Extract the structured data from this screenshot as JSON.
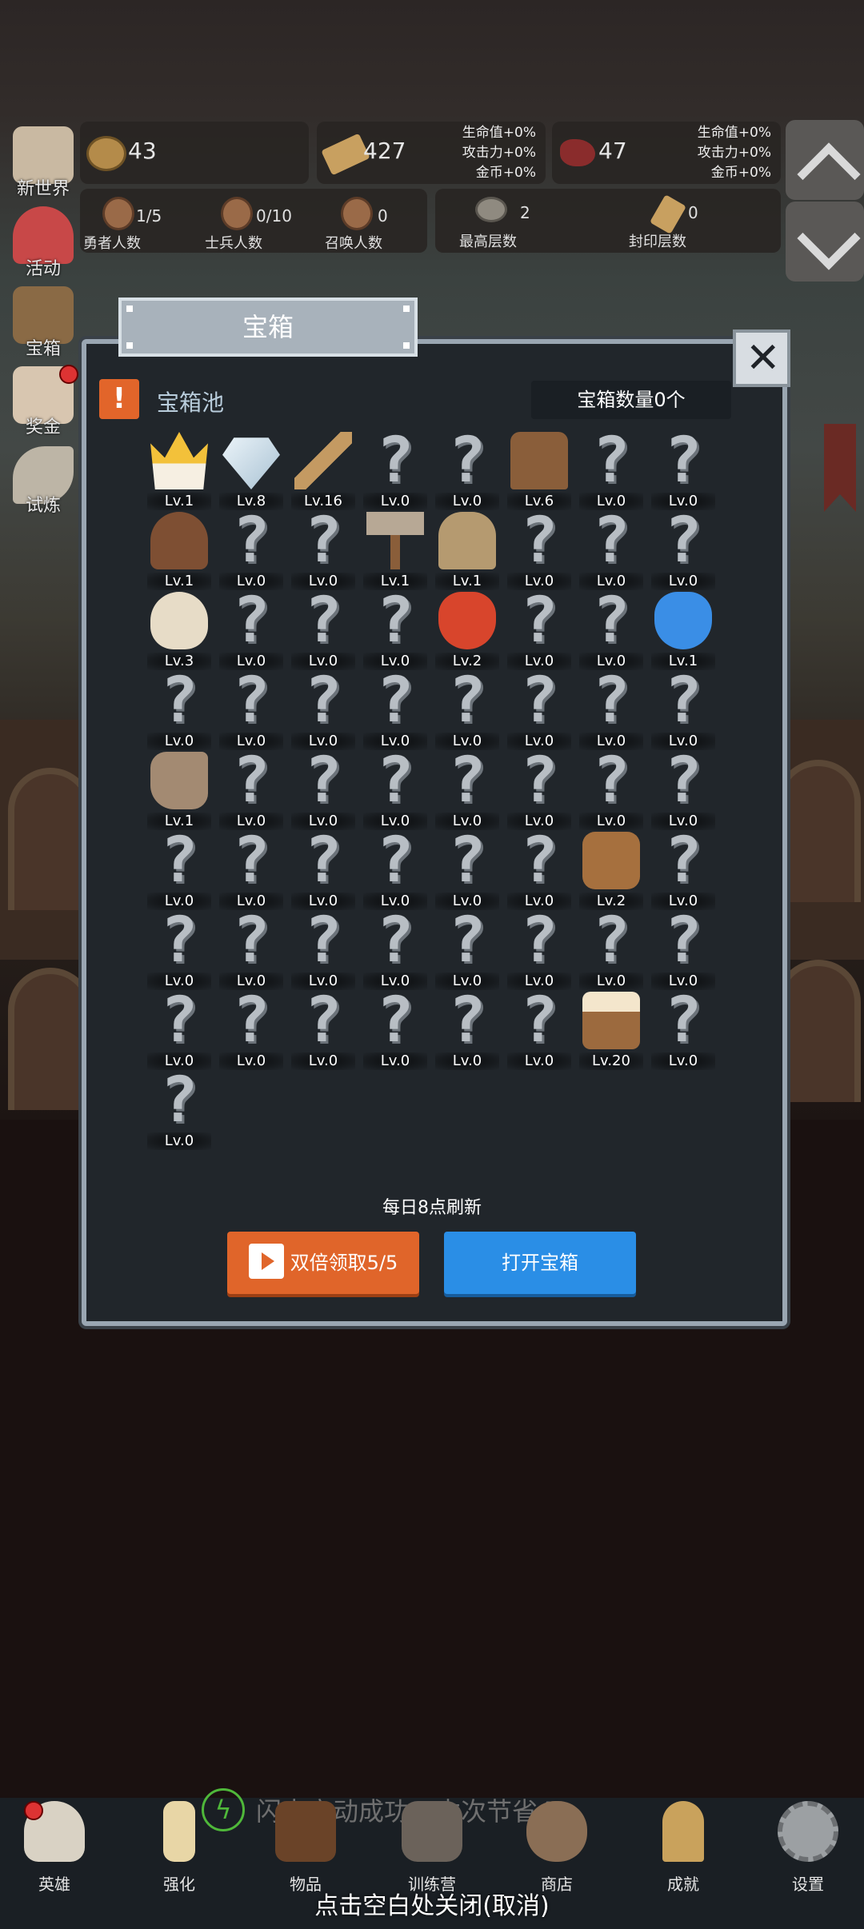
{
  "resources": [
    {
      "name": "coin",
      "value": "43",
      "icon": "coin-icon"
    },
    {
      "name": "wood",
      "value": "427",
      "icon": "wood-icon",
      "bonus": [
        "生命值+0%",
        "攻击力+0%",
        "金币+0%"
      ]
    },
    {
      "name": "meat",
      "value": "47",
      "icon": "meat-icon",
      "bonus": [
        "生命值+0%",
        "攻击力+0%",
        "金币+0%"
      ]
    }
  ],
  "stats": [
    {
      "label": "勇者人数",
      "value": "1/5"
    },
    {
      "label": "士兵人数",
      "value": "0/10"
    },
    {
      "label": "召唤人数",
      "value": "0"
    },
    {
      "label": "最高层数",
      "value": "2"
    },
    {
      "label": "封印层数",
      "value": "0"
    }
  ],
  "side_menu": [
    {
      "label": "新世界",
      "icon": "map-icon"
    },
    {
      "label": "活动",
      "icon": "heart-icon"
    },
    {
      "label": "宝箱",
      "icon": "chest-icon"
    },
    {
      "label": "奖金",
      "icon": "letter-icon"
    },
    {
      "label": "试炼",
      "icon": "feather-icon"
    }
  ],
  "modal": {
    "title": "宝箱",
    "pool_title": "宝箱池",
    "pool_alert": "!",
    "chest_count": "宝箱数量0个",
    "refresh_note": "每日8点刷新",
    "double_claim": "双倍领取5/5",
    "open_chest": "打开宝箱",
    "close_glyph": "✕"
  },
  "items": [
    {
      "icon": "crown-icon",
      "level": "Lv.1"
    },
    {
      "icon": "diamond-icon",
      "level": "Lv.8"
    },
    {
      "icon": "sword-icon",
      "level": "Lv.16"
    },
    {
      "icon": "unknown-icon",
      "level": "Lv.0"
    },
    {
      "icon": "unknown-icon",
      "level": "Lv.0"
    },
    {
      "icon": "armor-icon",
      "level": "Lv.6"
    },
    {
      "icon": "unknown-icon",
      "level": "Lv.0"
    },
    {
      "icon": "unknown-icon",
      "level": "Lv.0"
    },
    {
      "icon": "leather-helmet-icon",
      "level": "Lv.1"
    },
    {
      "icon": "unknown-icon",
      "level": "Lv.0"
    },
    {
      "icon": "unknown-icon",
      "level": "Lv.0"
    },
    {
      "icon": "hammer-icon",
      "level": "Lv.1"
    },
    {
      "icon": "knight-helmet-icon",
      "level": "Lv.1"
    },
    {
      "icon": "unknown-icon",
      "level": "Lv.0"
    },
    {
      "icon": "unknown-icon",
      "level": "Lv.0"
    },
    {
      "icon": "unknown-icon",
      "level": "Lv.0"
    },
    {
      "icon": "flour-icon",
      "level": "Lv.3"
    },
    {
      "icon": "unknown-icon",
      "level": "Lv.0"
    },
    {
      "icon": "unknown-icon",
      "level": "Lv.0"
    },
    {
      "icon": "unknown-icon",
      "level": "Lv.0"
    },
    {
      "icon": "red-potion-icon",
      "level": "Lv.2"
    },
    {
      "icon": "unknown-icon",
      "level": "Lv.0"
    },
    {
      "icon": "unknown-icon",
      "level": "Lv.0"
    },
    {
      "icon": "blue-potion-icon",
      "level": "Lv.1"
    },
    {
      "icon": "unknown-icon",
      "level": "Lv.0"
    },
    {
      "icon": "unknown-icon",
      "level": "Lv.0"
    },
    {
      "icon": "unknown-icon",
      "level": "Lv.0"
    },
    {
      "icon": "unknown-icon",
      "level": "Lv.0"
    },
    {
      "icon": "unknown-icon",
      "level": "Lv.0"
    },
    {
      "icon": "unknown-icon",
      "level": "Lv.0"
    },
    {
      "icon": "unknown-icon",
      "level": "Lv.0"
    },
    {
      "icon": "unknown-icon",
      "level": "Lv.0"
    },
    {
      "icon": "boot-icon",
      "level": "Lv.1"
    },
    {
      "icon": "unknown-icon",
      "level": "Lv.0"
    },
    {
      "icon": "unknown-icon",
      "level": "Lv.0"
    },
    {
      "icon": "unknown-icon",
      "level": "Lv.0"
    },
    {
      "icon": "unknown-icon",
      "level": "Lv.0"
    },
    {
      "icon": "unknown-icon",
      "level": "Lv.0"
    },
    {
      "icon": "unknown-icon",
      "level": "Lv.0"
    },
    {
      "icon": "unknown-icon",
      "level": "Lv.0"
    },
    {
      "icon": "unknown-icon",
      "level": "Lv.0"
    },
    {
      "icon": "unknown-icon",
      "level": "Lv.0"
    },
    {
      "icon": "unknown-icon",
      "level": "Lv.0"
    },
    {
      "icon": "unknown-icon",
      "level": "Lv.0"
    },
    {
      "icon": "unknown-icon",
      "level": "Lv.0"
    },
    {
      "icon": "unknown-icon",
      "level": "Lv.0"
    },
    {
      "icon": "backpack-icon",
      "level": "Lv.2"
    },
    {
      "icon": "unknown-icon",
      "level": "Lv.0"
    },
    {
      "icon": "unknown-icon",
      "level": "Lv.0"
    },
    {
      "icon": "unknown-icon",
      "level": "Lv.0"
    },
    {
      "icon": "unknown-icon",
      "level": "Lv.0"
    },
    {
      "icon": "unknown-icon",
      "level": "Lv.0"
    },
    {
      "icon": "unknown-icon",
      "level": "Lv.0"
    },
    {
      "icon": "unknown-icon",
      "level": "Lv.0"
    },
    {
      "icon": "unknown-icon",
      "level": "Lv.0"
    },
    {
      "icon": "unknown-icon",
      "level": "Lv.0"
    },
    {
      "icon": "unknown-icon",
      "level": "Lv.0"
    },
    {
      "icon": "unknown-icon",
      "level": "Lv.0"
    },
    {
      "icon": "unknown-icon",
      "level": "Lv.0"
    },
    {
      "icon": "unknown-icon",
      "level": "Lv.0"
    },
    {
      "icon": "unknown-icon",
      "level": "Lv.0"
    },
    {
      "icon": "unknown-icon",
      "level": "Lv.0"
    },
    {
      "icon": "beer-mug-icon",
      "level": "Lv.20"
    },
    {
      "icon": "unknown-icon",
      "level": "Lv.0"
    },
    {
      "icon": "unknown-icon",
      "level": "Lv.0"
    }
  ],
  "unknown_glyph": "?",
  "toast": "闪电启动成功，本次节省4 s",
  "tabs": [
    {
      "label": "英雄",
      "icon": "skull-icon"
    },
    {
      "label": "强化",
      "icon": "candle-icon"
    },
    {
      "label": "物品",
      "icon": "book-icon"
    },
    {
      "label": "训练营",
      "icon": "lantern-icon"
    },
    {
      "label": "商店",
      "icon": "pot-icon"
    },
    {
      "label": "成就",
      "icon": "key-icon"
    },
    {
      "label": "设置",
      "icon": "gear-icon"
    }
  ],
  "close_hint": "点击空白处关闭(取消)",
  "colors": {
    "accent_orange": "#e0652a",
    "accent_blue": "#2a8ee6",
    "panel": "#21262b",
    "frame": "#9aa6b2"
  }
}
